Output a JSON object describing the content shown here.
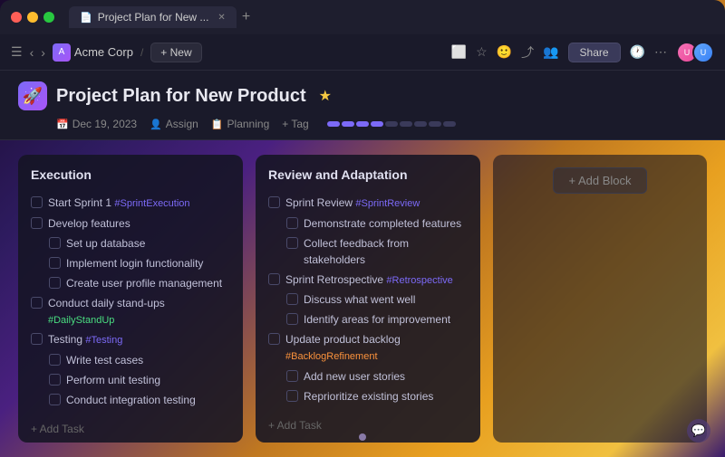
{
  "window": {
    "title": "Project Plan for New ...",
    "tabs": [
      {
        "label": "Project Plan for New ...",
        "icon": "📄"
      }
    ]
  },
  "toolbar": {
    "workspace": "Acme Corp",
    "new_label": "+ New",
    "share_label": "Share"
  },
  "page": {
    "title": "Project Plan for New Product",
    "date": "Dec 19, 2023",
    "assign_label": "Assign",
    "planning_label": "Planning",
    "tag_label": "+ Tag"
  },
  "execution": {
    "title": "Execution",
    "tasks": [
      {
        "text": "Start Sprint 1 ",
        "tag": "#SprintExecution",
        "tag_color": "purple",
        "checked": false,
        "indent": false
      },
      {
        "text": "Develop features",
        "tag": "",
        "tag_color": "",
        "checked": false,
        "indent": false
      },
      {
        "text": "Set up database",
        "tag": "",
        "tag_color": "",
        "checked": false,
        "indent": true
      },
      {
        "text": "Implement login functionality",
        "tag": "",
        "tag_color": "",
        "checked": false,
        "indent": true
      },
      {
        "text": "Create user profile management",
        "tag": "",
        "tag_color": "",
        "checked": false,
        "indent": true
      },
      {
        "text": "Conduct daily stand-ups ",
        "tag": "#DailyStandUp",
        "tag_color": "green",
        "checked": false,
        "indent": false
      },
      {
        "text": "Testing ",
        "tag": "#Testing",
        "tag_color": "purple",
        "checked": false,
        "indent": false
      },
      {
        "text": "Write test cases",
        "tag": "",
        "tag_color": "",
        "checked": false,
        "indent": true
      },
      {
        "text": "Perform unit testing",
        "tag": "",
        "tag_color": "",
        "checked": false,
        "indent": true
      },
      {
        "text": "Conduct integration testing",
        "tag": "",
        "tag_color": "",
        "checked": false,
        "indent": true
      }
    ],
    "add_task_label": "+ Add Task"
  },
  "review": {
    "title": "Review and Adaptation",
    "tasks": [
      {
        "text": "Sprint Review ",
        "tag": "#SprintReview",
        "tag_color": "purple",
        "checked": false,
        "indent": false
      },
      {
        "text": "Demonstrate completed features",
        "tag": "",
        "tag_color": "",
        "checked": false,
        "indent": true
      },
      {
        "text": "Collect feedback from stakeholders",
        "tag": "",
        "tag_color": "",
        "checked": false,
        "indent": true
      },
      {
        "text": "Sprint Retrospective ",
        "tag": "#Retrospective",
        "tag_color": "purple",
        "checked": false,
        "indent": false
      },
      {
        "text": "Discuss what went well",
        "tag": "",
        "tag_color": "",
        "checked": false,
        "indent": true
      },
      {
        "text": "Identify areas for improvement",
        "tag": "",
        "tag_color": "",
        "checked": false,
        "indent": true
      },
      {
        "text": "Update product backlog ",
        "tag": "#BacklogRefinement",
        "tag_color": "orange",
        "checked": false,
        "indent": false
      },
      {
        "text": "Add new user stories",
        "tag": "",
        "tag_color": "",
        "checked": false,
        "indent": true
      },
      {
        "text": "Reprioritize existing stories",
        "tag": "",
        "tag_color": "",
        "checked": false,
        "indent": true
      }
    ],
    "add_task_label": "+ Add Task"
  },
  "add_block": {
    "label": "+ Add Block"
  }
}
